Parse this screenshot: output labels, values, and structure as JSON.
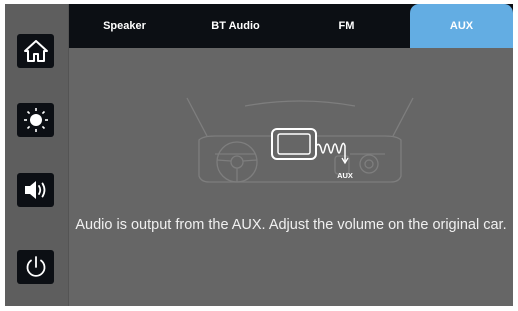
{
  "sidebar": {
    "items": [
      {
        "icon": "home-icon"
      },
      {
        "icon": "brightness-icon"
      },
      {
        "icon": "volume-icon"
      },
      {
        "icon": "power-icon"
      }
    ]
  },
  "tabs": [
    {
      "label": "Speaker",
      "active": false
    },
    {
      "label": "BT Audio",
      "active": false
    },
    {
      "label": "FM",
      "active": false
    },
    {
      "label": "AUX",
      "active": true
    }
  ],
  "illustration": {
    "port_label": "AUX"
  },
  "message": "Audio is output from the AUX. Adjust the volume on the original car.",
  "colors": {
    "background": "#666666",
    "bar": "#0c0f14",
    "active_tab": "#63ade3",
    "text": "#ffffff"
  }
}
